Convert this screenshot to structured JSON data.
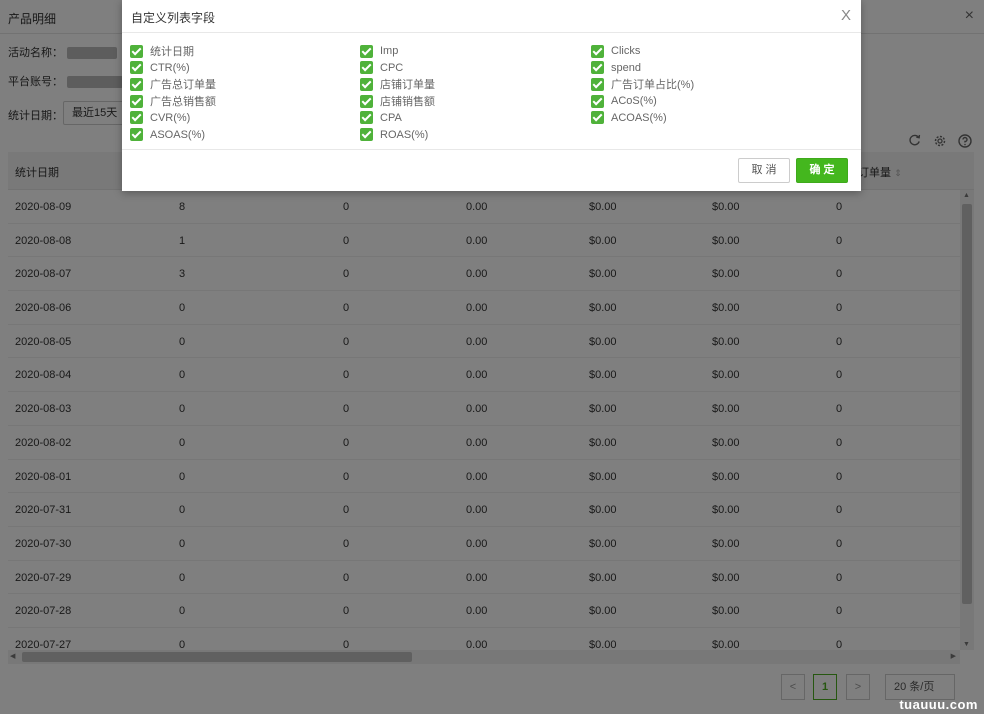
{
  "page": {
    "title": "产品明细",
    "close_glyph": "×",
    "activity_label": "活动名称：",
    "account_label": "平台账号：",
    "date_label": "统计日期：",
    "date_range": "最近15天"
  },
  "table": {
    "headers": [
      "统计日期",
      "订单量"
    ],
    "rows": [
      [
        "2020-08-09",
        "8",
        "0",
        "0.00",
        "$0.00",
        "$0.00",
        "0"
      ],
      [
        "2020-08-08",
        "1",
        "0",
        "0.00",
        "$0.00",
        "$0.00",
        "0"
      ],
      [
        "2020-08-07",
        "3",
        "0",
        "0.00",
        "$0.00",
        "$0.00",
        "0"
      ],
      [
        "2020-08-06",
        "0",
        "0",
        "0.00",
        "$0.00",
        "$0.00",
        "0"
      ],
      [
        "2020-08-05",
        "0",
        "0",
        "0.00",
        "$0.00",
        "$0.00",
        "0"
      ],
      [
        "2020-08-04",
        "0",
        "0",
        "0.00",
        "$0.00",
        "$0.00",
        "0"
      ],
      [
        "2020-08-03",
        "0",
        "0",
        "0.00",
        "$0.00",
        "$0.00",
        "0"
      ],
      [
        "2020-08-02",
        "0",
        "0",
        "0.00",
        "$0.00",
        "$0.00",
        "0"
      ],
      [
        "2020-08-01",
        "0",
        "0",
        "0.00",
        "$0.00",
        "$0.00",
        "0"
      ],
      [
        "2020-07-31",
        "0",
        "0",
        "0.00",
        "$0.00",
        "$0.00",
        "0"
      ],
      [
        "2020-07-30",
        "0",
        "0",
        "0.00",
        "$0.00",
        "$0.00",
        "0"
      ],
      [
        "2020-07-29",
        "0",
        "0",
        "0.00",
        "$0.00",
        "$0.00",
        "0"
      ],
      [
        "2020-07-28",
        "0",
        "0",
        "0.00",
        "$0.00",
        "$0.00",
        "0"
      ],
      [
        "2020-07-27",
        "0",
        "0",
        "0.00",
        "$0.00",
        "$0.00",
        "0"
      ]
    ]
  },
  "pagination": {
    "prev": "<",
    "current": "1",
    "next": ">",
    "page_size": "20 条/页"
  },
  "watermark": "tuauuu.com",
  "modal": {
    "title": "自定义列表字段",
    "close_glyph": "X",
    "fields": [
      [
        "统计日期",
        "Imp",
        "Clicks"
      ],
      [
        "CTR(%)",
        "CPC",
        "spend"
      ],
      [
        "广告总订单量",
        "店铺订单量",
        "广告订单占比(%)"
      ],
      [
        "广告总销售额",
        "店铺销售额",
        "ACoS(%)"
      ],
      [
        "CVR(%)",
        "CPA",
        "ACOAS(%)"
      ],
      [
        "ASOAS(%)",
        "ROAS(%)"
      ]
    ],
    "cancel_label": "取 消",
    "ok_label": "确 定"
  },
  "colors": {
    "accent": "#44b71e",
    "checkbox": "#4fb23a"
  },
  "icons": [
    "refresh-icon",
    "gear-icon",
    "help-icon"
  ]
}
